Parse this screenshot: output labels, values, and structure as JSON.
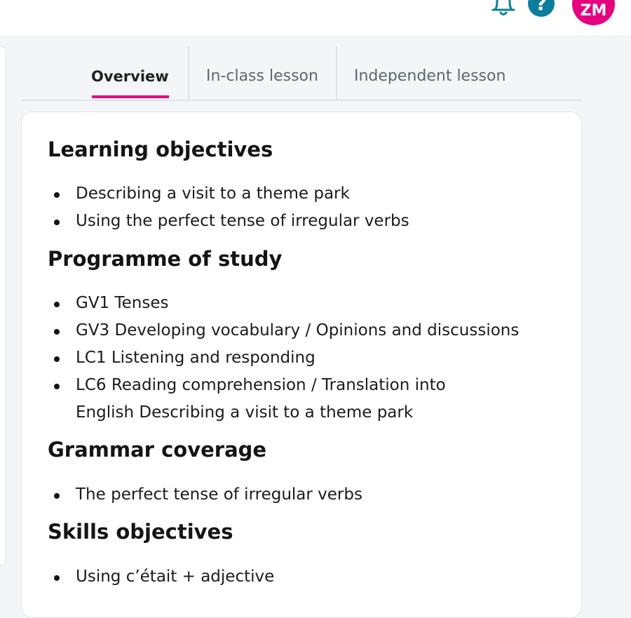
{
  "header": {
    "avatar_initials": "ZM",
    "help_label": "?",
    "icons": [
      "bell-icon",
      "help-icon"
    ],
    "colors": {
      "help": "#0e7d9b",
      "avatar": "#e6007e"
    }
  },
  "tabs": [
    {
      "label": "Overview",
      "active": true
    },
    {
      "label": "In-class lesson",
      "active": false
    },
    {
      "label": "Independent lesson",
      "active": false
    }
  ],
  "accent_color": "#e6007e",
  "sections": {
    "learning_objectives": {
      "title": "Learning objectives",
      "items": [
        "Describing a visit to a theme park",
        "Using the perfect tense of irregular verbs"
      ]
    },
    "programme_of_study": {
      "title": "Programme of study",
      "items": [
        "GV1 Tenses",
        "GV3 Developing  vocabulary / Opinions and discussions",
        "LC1 Listening and responding",
        "LC6 Reading comprehension / Translation into",
        "English Describing a visit to a theme park"
      ]
    },
    "grammar_coverage": {
      "title": "Grammar coverage",
      "items": [
        "The perfect tense of irregular verbs"
      ]
    },
    "skills_objectives": {
      "title": "Skills objectives",
      "items": [
        "Using c’était + adjective"
      ]
    }
  }
}
